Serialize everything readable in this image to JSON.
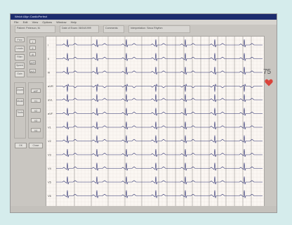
{
  "window": {
    "title": "Welch Allyn CardioPerfect"
  },
  "menu": [
    "File",
    "Edit",
    "View",
    "Options",
    "Window",
    "Help"
  ],
  "info": {
    "patient": "Patient: Peterson, M.",
    "exam": "Date of Exam: 06/04/1999",
    "comments": "Comments:",
    "interpretation": "Interpretation: Sinus Rhythm"
  },
  "sidebar": {
    "buttons": [
      "Print",
      "Leads",
      "Filter",
      "Speed",
      "Gain",
      "Zoom",
      "Mode",
      "Tools",
      "OK",
      "Close"
    ],
    "options": [
      "I",
      "II",
      "III",
      "aVR",
      "aVL",
      "aVF",
      "V1",
      "V2",
      "V3",
      "V4"
    ]
  },
  "leads": [
    "I",
    "II",
    "III",
    "aVR",
    "aVL",
    "aVF",
    "V1",
    "V2",
    "V3",
    "V4",
    "V5",
    "V6"
  ],
  "heart_rate": {
    "value": "75",
    "heart_color": "#d9433a"
  },
  "colors": {
    "trace": "#2b2f6f",
    "grid_minor": "#ece5de",
    "grid_major": "#a7a3a0",
    "titlebar": "#1c2c6e"
  }
}
